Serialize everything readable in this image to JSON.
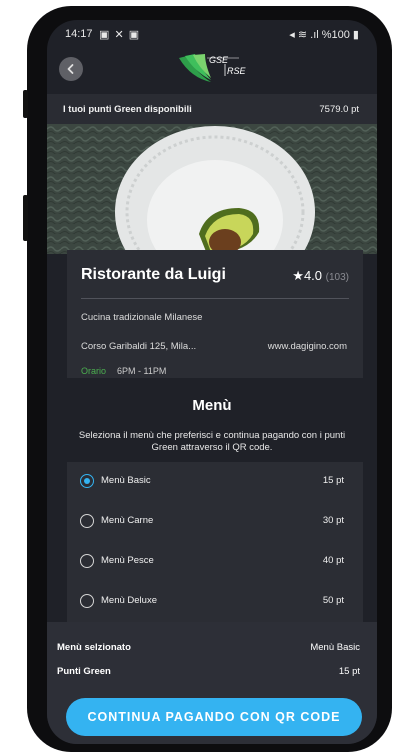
{
  "status_bar": {
    "time": "14:17",
    "notification_icons": "▣ ✕ ▣",
    "right_icons": "◂ ≋ .ıl %100 ▮"
  },
  "header": {
    "back_icon": "chevron-left-icon",
    "logo_text_1": "GSE",
    "logo_text_2": "RSE"
  },
  "points": {
    "label": "I tuoi punti Green disponibili",
    "value": "7579.0 pt"
  },
  "restaurant": {
    "name": "Ristorante da Luigi",
    "rating_star": "★",
    "rating": "4.0",
    "reviews": "(103)",
    "cuisine": "Cucina tradizionale Milanese",
    "address": "Corso Garibaldi 125, Mila...",
    "website": "www.dagigino.com",
    "hours_label": "Orario",
    "hours": "6PM - 11PM"
  },
  "menu": {
    "title": "Menù",
    "subtitle": "Seleziona il menù che preferisci e continua pagando con i punti Green attraverso il QR code.",
    "options": [
      {
        "label": "Menù Basic",
        "points": "15 pt",
        "selected": true
      },
      {
        "label": "Menù Carne",
        "points": "30 pt",
        "selected": false
      },
      {
        "label": "Menù Pesce",
        "points": "40 pt",
        "selected": false
      },
      {
        "label": "Menù Deluxe",
        "points": "50 pt",
        "selected": false
      }
    ]
  },
  "summary": {
    "selected_label": "Menù selzionato",
    "selected_value": "Menù Basic",
    "points_label": "Punti Green",
    "points_value": "15 pt"
  },
  "cta": {
    "label": "CONTINUA PAGANDO CON QR CODE"
  },
  "colors": {
    "accent": "#34b3f1",
    "background": "#1f2128",
    "card": "#2b2d34",
    "hours_green": "#4caf50"
  }
}
